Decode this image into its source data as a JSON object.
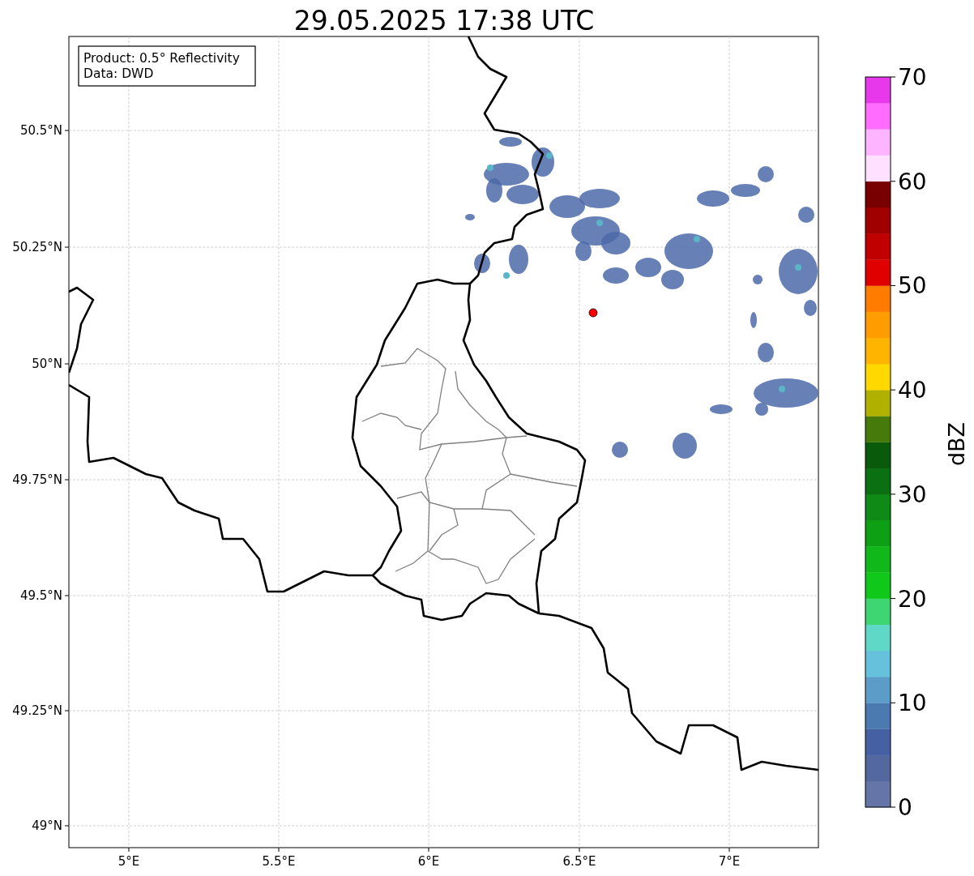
{
  "title": "29.05.2025 17:38 UTC",
  "info_box": {
    "lines": [
      "Product: 0.5° Reflectivity",
      "Data: DWD"
    ]
  },
  "map": {
    "y_ticks": [
      "50.5°N",
      "50.25°N",
      "50°N",
      "49.75°N",
      "49.5°N",
      "49.25°N",
      "49°N"
    ],
    "x_ticks": [
      "5°E",
      "5.5°E",
      "6°E",
      "6.5°E",
      "7°E"
    ]
  },
  "colorbar": {
    "label": "dBZ",
    "ticks": [
      "70",
      "60",
      "50",
      "40",
      "30",
      "20",
      "10",
      "0"
    ],
    "bins": [
      {
        "color": "#6675a8"
      },
      {
        "color": "#5468a0"
      },
      {
        "color": "#4560a3"
      },
      {
        "color": "#4a7ab0"
      },
      {
        "color": "#5b9dc8"
      },
      {
        "color": "#66c2dc"
      },
      {
        "color": "#60d8c8"
      },
      {
        "color": "#3dd672"
      },
      {
        "color": "#10c81a"
      },
      {
        "color": "#10b81a"
      },
      {
        "color": "#0ea014"
      },
      {
        "color": "#0f8a16"
      },
      {
        "color": "#0a7012"
      },
      {
        "color": "#0a5a0c"
      },
      {
        "color": "#467a0a"
      },
      {
        "color": "#b0b000"
      },
      {
        "color": "#ffd800"
      },
      {
        "color": "#ffb400"
      },
      {
        "color": "#ff9c00"
      },
      {
        "color": "#ff7c00"
      },
      {
        "color": "#e00000"
      },
      {
        "color": "#c00000"
      },
      {
        "color": "#a00000"
      },
      {
        "color": "#780000"
      },
      {
        "color": "#ffe0ff"
      },
      {
        "color": "#ffb4ff"
      },
      {
        "color": "#ff6cff"
      },
      {
        "color": "#e838ec"
      }
    ]
  }
}
